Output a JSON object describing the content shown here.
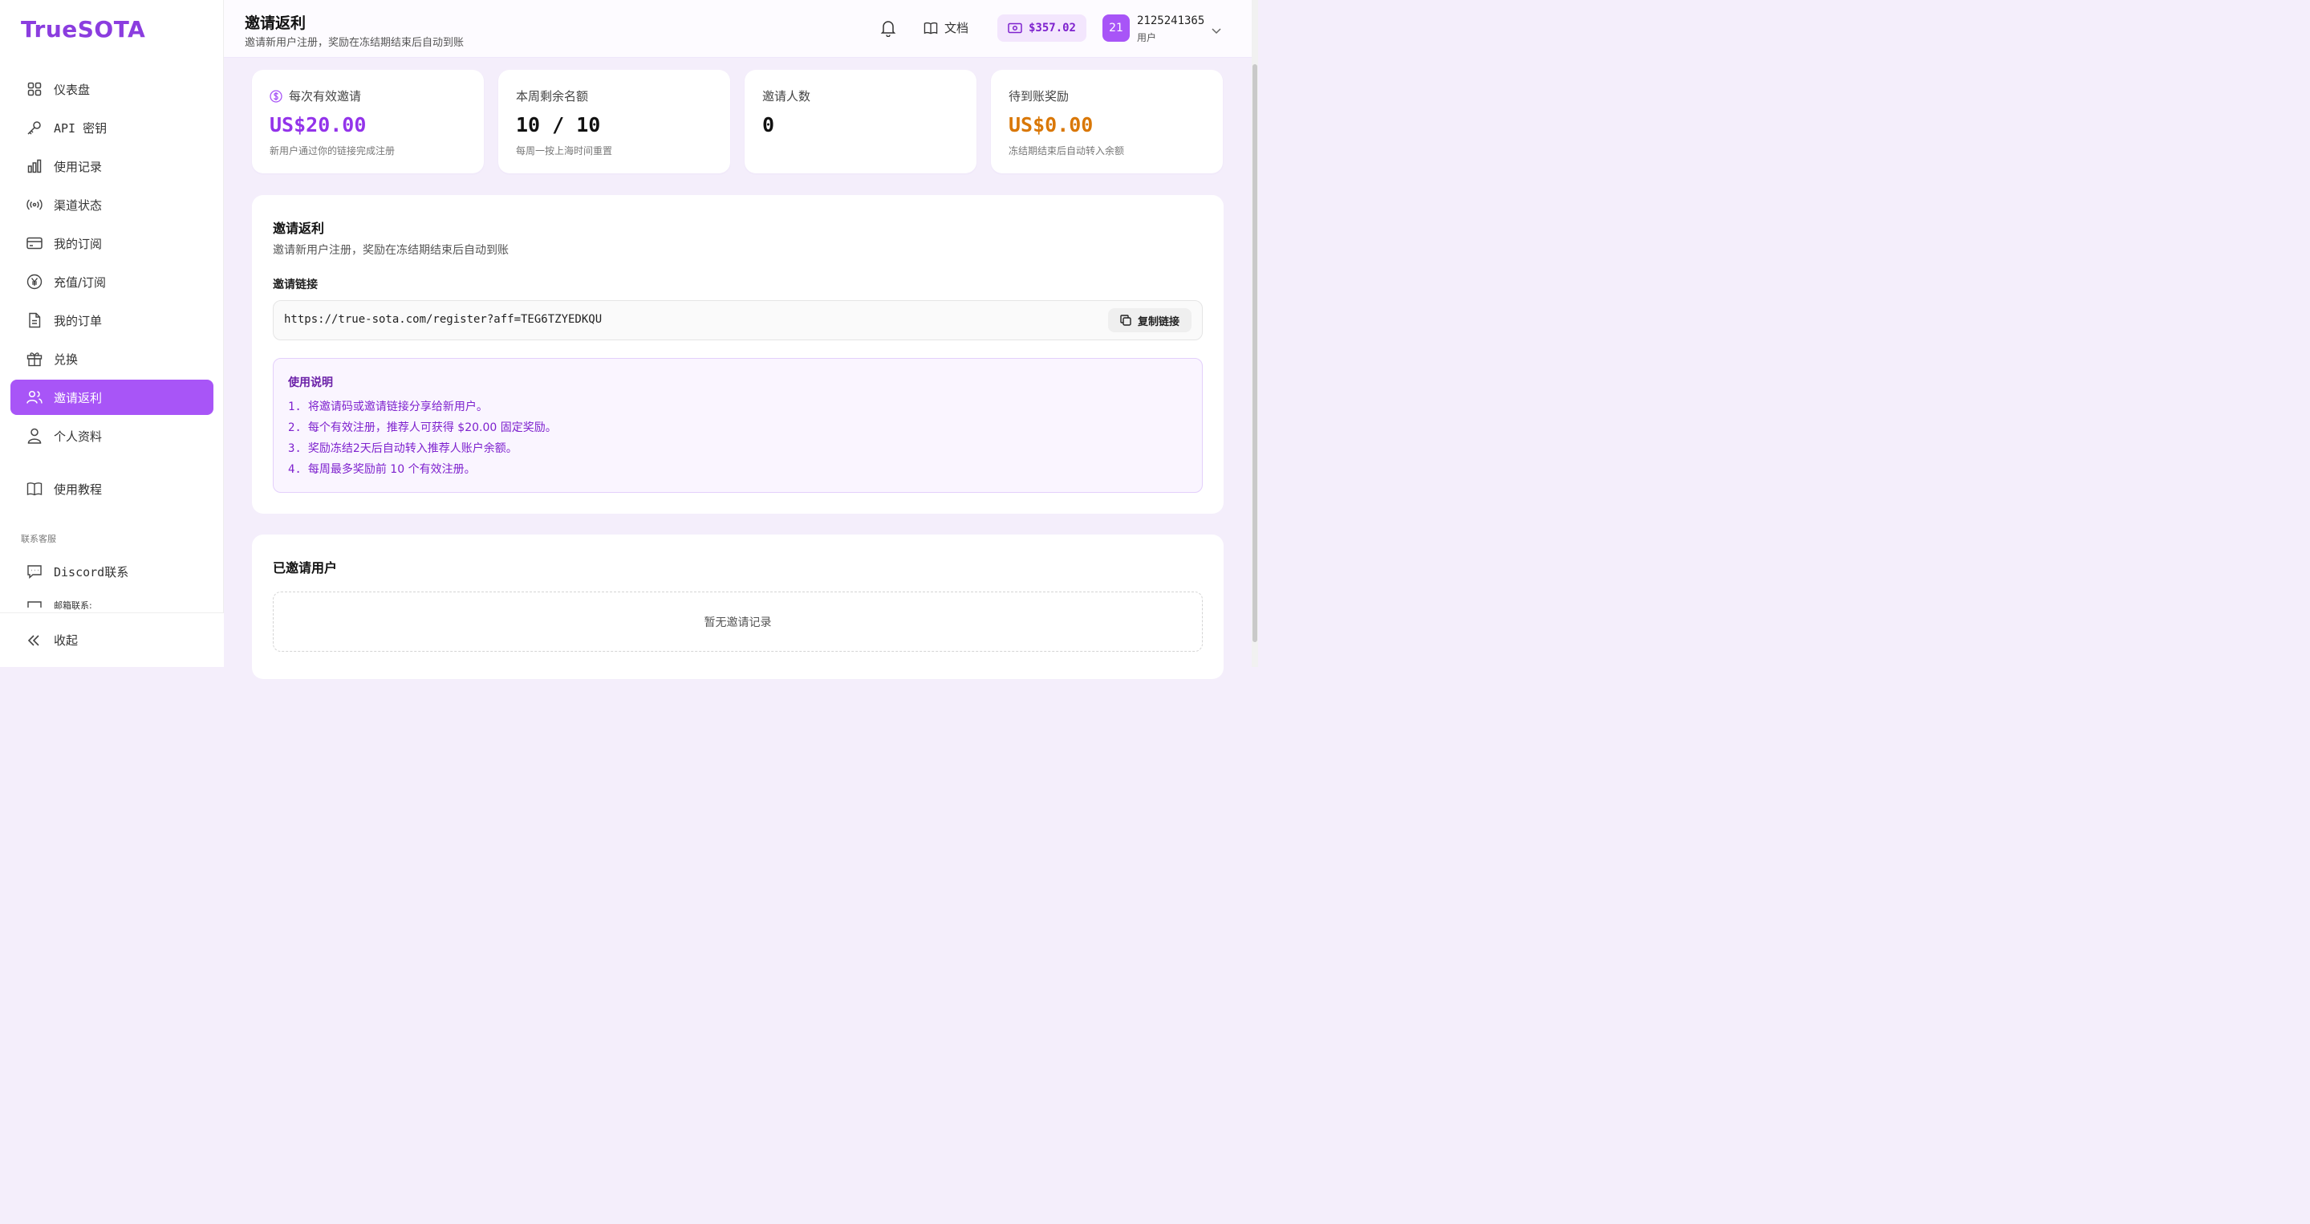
{
  "app": {
    "logo_main": "TrueSOTA"
  },
  "sidebar": {
    "items": [
      {
        "label": "仪表盘",
        "icon": "dashboard-icon"
      },
      {
        "label": "API 密钥",
        "icon": "key-icon"
      },
      {
        "label": "使用记录",
        "icon": "bar-chart-icon"
      },
      {
        "label": "渠道状态",
        "icon": "signal-icon"
      },
      {
        "label": "我的订阅",
        "icon": "credit-card-icon"
      },
      {
        "label": "充值/订阅",
        "icon": "yen-icon"
      },
      {
        "label": "我的订单",
        "icon": "document-icon"
      },
      {
        "label": "兑换",
        "icon": "gift-icon"
      },
      {
        "label": "邀请返利",
        "icon": "users-icon"
      },
      {
        "label": "个人资料",
        "icon": "user-icon"
      }
    ],
    "tutorial": "使用教程",
    "contact_section": "联系客服",
    "discord": "Discord联系",
    "email_partial": "邮箱联系:",
    "collapse": "收起"
  },
  "header": {
    "title": "邀请返利",
    "subtitle": "邀请新用户注册，奖励在冻结期结束后自动到账",
    "docs": "文档",
    "balance": "$357.02",
    "avatar": "21",
    "user_id": "2125241365",
    "user_role": "用户"
  },
  "stats": [
    {
      "label": "每次有效邀请",
      "value": "US$20.00",
      "note": "新用户通过你的链接完成注册",
      "color": "#9333ea"
    },
    {
      "label": "本周剩余名额",
      "value": "10 / 10",
      "note": "每周一按上海时间重置",
      "color": "#111111"
    },
    {
      "label": "邀请人数",
      "value": "0",
      "note": "",
      "color": "#111111"
    },
    {
      "label": "待到账奖励",
      "value": "US$0.00",
      "note": "冻结期结束后自动转入余额",
      "color": "#d97706"
    }
  ],
  "invite": {
    "title": "邀请返利",
    "subtitle": "邀请新用户注册，奖励在冻结期结束后自动到账",
    "link_label": "邀请链接",
    "link": "https://true-sota.com/register?aff=TEG6TZYEDKQU",
    "copy_button": "复制链接",
    "usage_title": "使用说明",
    "usage": [
      {
        "num": "1.",
        "text": "将邀请码或邀请链接分享给新用户。"
      },
      {
        "num": "2.",
        "text": "每个有效注册，推荐人可获得 $20.00 固定奖励。"
      },
      {
        "num": "3.",
        "text": "奖励冻结2天后自动转入推荐人账户余额。"
      },
      {
        "num": "4.",
        "text": "每周最多奖励前 10 个有效注册。"
      }
    ]
  },
  "invited": {
    "title": "已邀请用户",
    "empty": "暂无邀请记录"
  }
}
